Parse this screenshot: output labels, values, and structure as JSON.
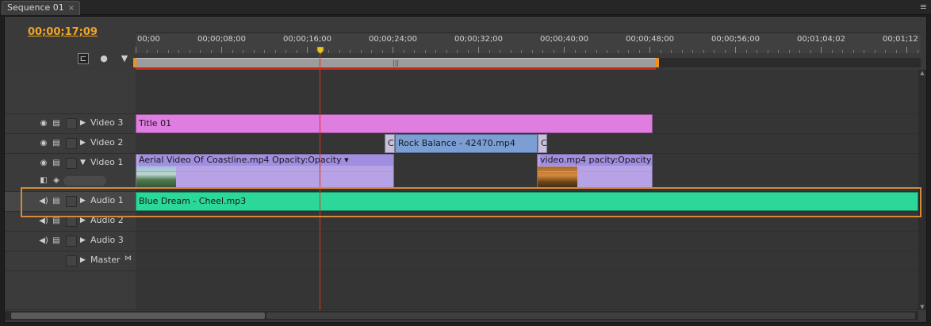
{
  "tab": {
    "label": "Sequence 01",
    "close": "×"
  },
  "panel_menu": "≡",
  "timecode": "00;00;17;09",
  "ruler": {
    "labels": [
      "00;00",
      "00;00;08;00",
      "00;00;16;00",
      "00;00;24;00",
      "00;00;32;00",
      "00;00;40;00",
      "00;00;48;00",
      "00;00;56;00",
      "00;01;04;02",
      "00;01;12"
    ]
  },
  "tools": {
    "snap": "snap-icon",
    "marker": "add-marker-icon",
    "flag": "marker-flag-icon"
  },
  "tracks": {
    "video3": {
      "name": "Video 3"
    },
    "video2": {
      "name": "Video 2"
    },
    "video1": {
      "name": "Video 1"
    },
    "audio1": {
      "name": "Audio 1"
    },
    "audio2": {
      "name": "Audio 2"
    },
    "audio3": {
      "name": "Audio 3"
    },
    "master": {
      "name": "Master"
    }
  },
  "clips": {
    "title": "Title 01",
    "v2_trans_left": "C",
    "v2_main": "Rock Balance - 42470.mp4",
    "v2_trans_right": "Cr",
    "v1_first": "Aerial Video Of Coastline.mp4",
    "v1_first_fx": "Opacity:Opacity ▾",
    "v1_second": "video.mp4",
    "v1_second_fx": "pacity:Opacity ▾",
    "audio": "Blue Dream - Cheel.mp3"
  },
  "colors": {
    "timecode": "#f0a526",
    "title_clip": "#e07de0",
    "video_clip": "#b8a2e6",
    "audio_clip": "#2bd89a",
    "playhead": "#e0311c"
  }
}
